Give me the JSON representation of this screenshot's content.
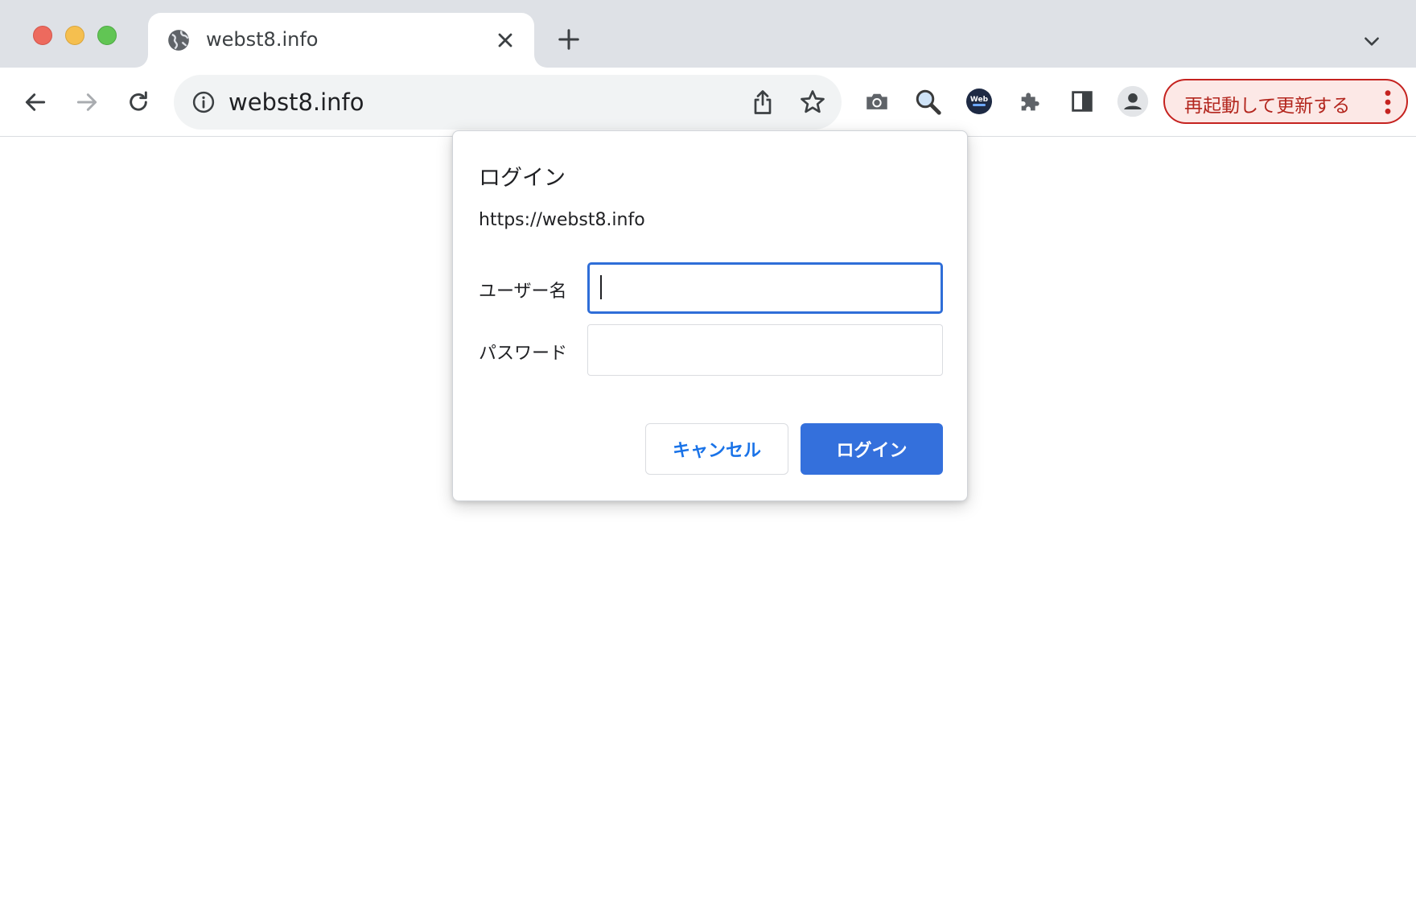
{
  "browser": {
    "tab": {
      "title": "webst8.info"
    },
    "omnibox": {
      "url": "webst8.info"
    },
    "restart_button": {
      "label": "再起動して更新する"
    },
    "extension_icons": [
      "camera-icon",
      "magnifier-icon",
      "webchatgpt-icon",
      "puzzle-icon",
      "side-panel-icon",
      "profile-icon"
    ],
    "extension_badge_text": "Web"
  },
  "dialog": {
    "title": "ログイン",
    "origin": "https://webst8.info",
    "username_label": "ユーザー名",
    "username_value": "",
    "password_label": "パスワード",
    "password_value": "",
    "cancel_label": "キャンセル",
    "login_label": "ログイン"
  },
  "colors": {
    "accent": "#3470dc",
    "restart_red": "#c5221f",
    "tabstrip": "#dee1e6"
  }
}
